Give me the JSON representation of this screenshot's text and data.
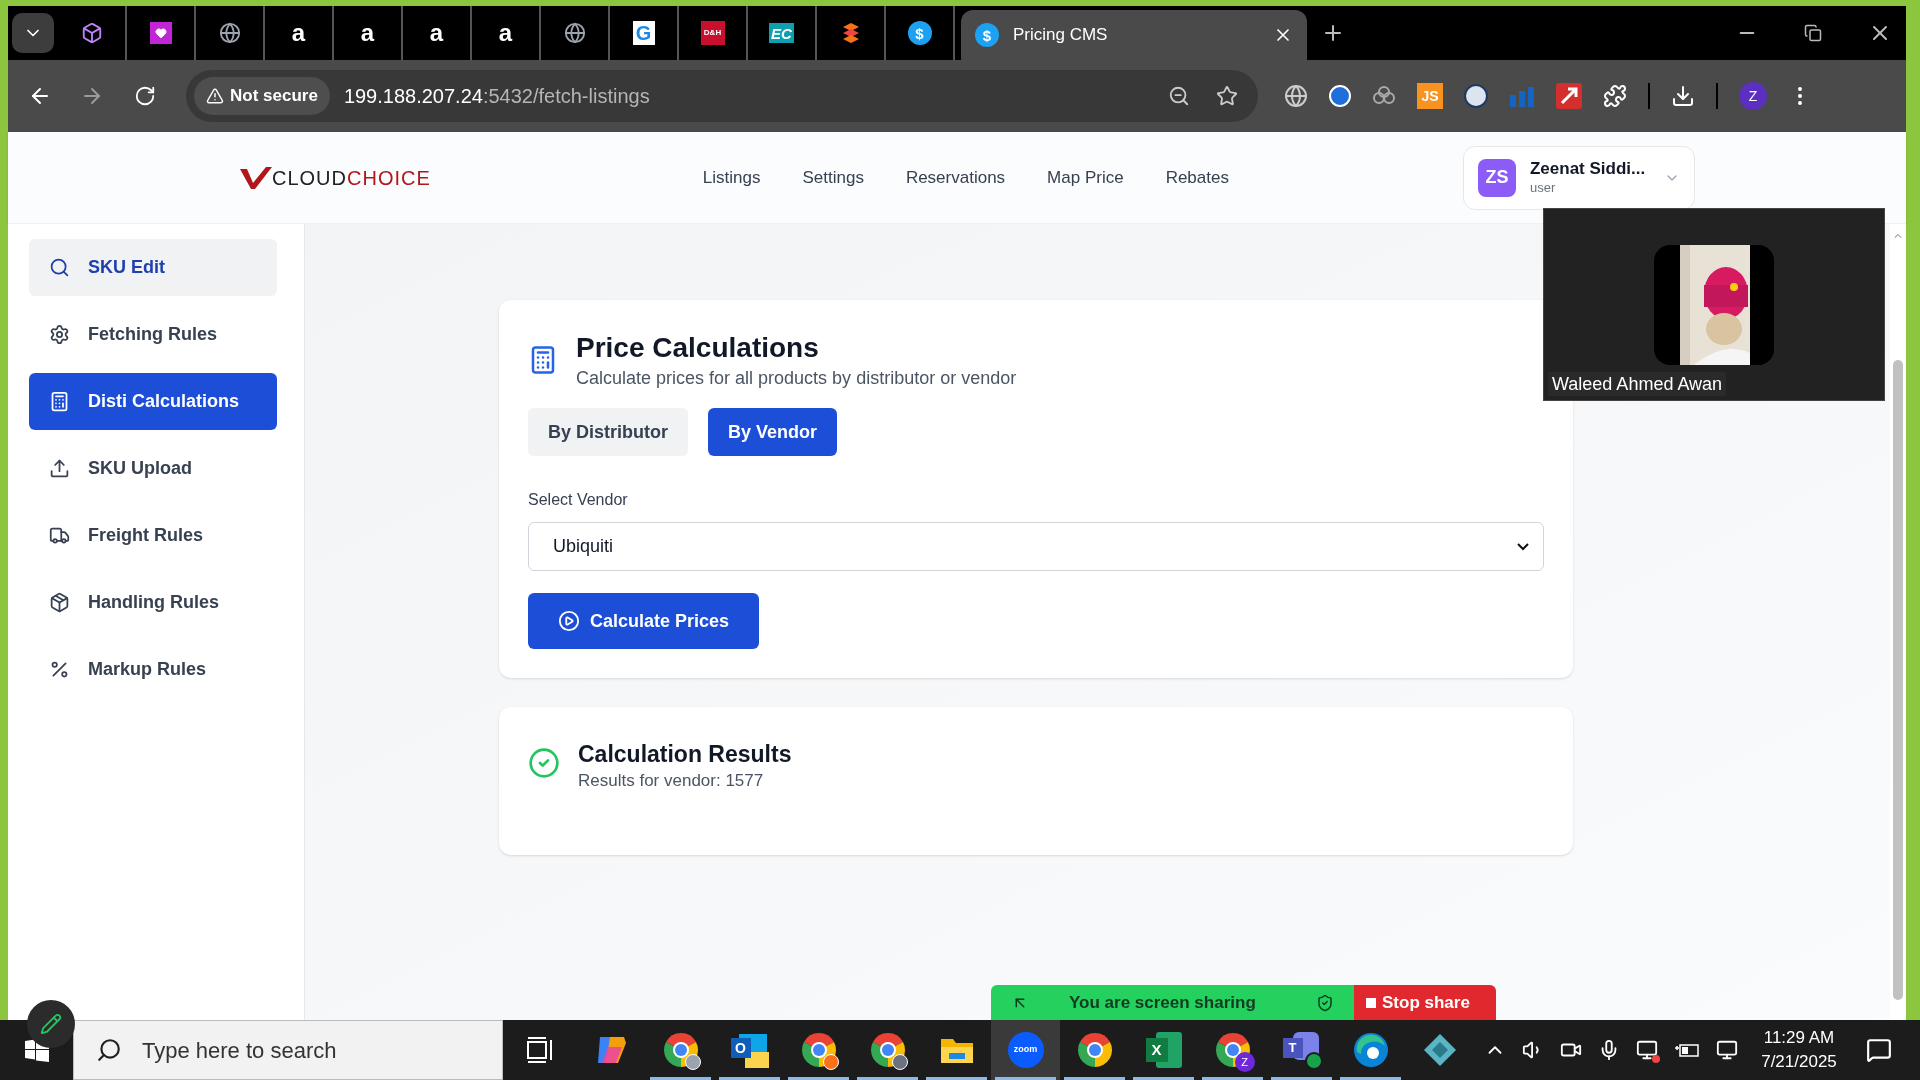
{
  "browser": {
    "tabs": [
      {
        "selected": false
      },
      {
        "selected": false
      },
      {
        "selected": false
      },
      {
        "glyph": "a",
        "selected": false
      },
      {
        "glyph": "a",
        "selected": false
      },
      {
        "glyph": "a",
        "selected": false
      },
      {
        "glyph": "a",
        "selected": false
      },
      {
        "selected": false
      },
      {
        "glyph": "G",
        "selected": false
      },
      {
        "glyph": "D&H",
        "selected": false
      },
      {
        "glyph": "EC",
        "selected": false
      },
      {
        "selected": false
      },
      {
        "glyph": "$",
        "selected": false
      },
      {
        "glyph": "$",
        "title": "Pricing CMS",
        "selected": true
      }
    ],
    "security": "Not secure",
    "url_host": "199.188.207.24",
    "url_path": ":5432/fetch-listings",
    "extension_glyph": "JS",
    "profile_initial": "Z"
  },
  "header": {
    "logo_left": "CLOUD",
    "logo_right": "CHOICE",
    "nav": [
      {
        "label": "Listings",
        "selected": false
      },
      {
        "label": "Settings",
        "selected": false
      },
      {
        "label": "Reservations",
        "selected": false
      },
      {
        "label": "Map Price",
        "selected": false
      },
      {
        "label": "Rebates",
        "selected": false
      }
    ],
    "user": {
      "initials": "ZS",
      "name": "Zeenat Siddi...",
      "role": "user"
    }
  },
  "sidebar": {
    "items": [
      {
        "label": "SKU Edit",
        "kind": "search",
        "selected": false,
        "hovered": true
      },
      {
        "label": "Fetching Rules",
        "kind": "gear",
        "selected": false,
        "hovered": false
      },
      {
        "label": "Disti Calculations",
        "kind": "calculator",
        "selected": true,
        "hovered": false
      },
      {
        "label": "SKU Upload",
        "kind": "upload",
        "selected": false,
        "hovered": false
      },
      {
        "label": "Freight Rules",
        "kind": "truck",
        "selected": false,
        "hovered": false
      },
      {
        "label": "Handling Rules",
        "kind": "package",
        "selected": false,
        "hovered": false
      },
      {
        "label": "Markup Rules",
        "kind": "percent",
        "selected": false,
        "hovered": false
      }
    ]
  },
  "calculator": {
    "title": "Price Calculations",
    "subtitle": "Calculate prices for all products by distributor or vendor",
    "modes": [
      {
        "label": "By Distributor",
        "selected": false
      },
      {
        "label": "By Vendor",
        "selected": true
      }
    ],
    "field_label": "Select Vendor",
    "vendor": "Ubiquiti",
    "button": "Calculate Prices"
  },
  "results": {
    "title": "Calculation Results",
    "text": "Results for vendor: 1577"
  },
  "video": {
    "participant": "Waleed Ahmed Awan"
  },
  "share_bar": {
    "status": "You are screen sharing",
    "stop": "Stop share"
  },
  "taskbar": {
    "search_placeholder": "Type here to search",
    "apps": [
      {
        "selected": false,
        "running": false
      },
      {
        "selected": false,
        "running": true
      },
      {
        "glyph": "O",
        "selected": false,
        "running": true
      },
      {
        "selected": false,
        "running": true
      },
      {
        "selected": false,
        "running": true
      },
      {
        "selected": false,
        "running": true
      },
      {
        "glyph": "zoom",
        "selected": true,
        "running": true
      },
      {
        "selected": false,
        "running": true
      },
      {
        "glyph": "X",
        "selected": false,
        "running": true
      },
      {
        "glyph": "Z",
        "selected": false,
        "running": true
      },
      {
        "glyph": "T",
        "selected": false,
        "running": true
      },
      {
        "selected": false,
        "running": true
      },
      {
        "selected": false,
        "running": false
      }
    ],
    "time": "11:29 AM",
    "date": "7/21/2025"
  }
}
